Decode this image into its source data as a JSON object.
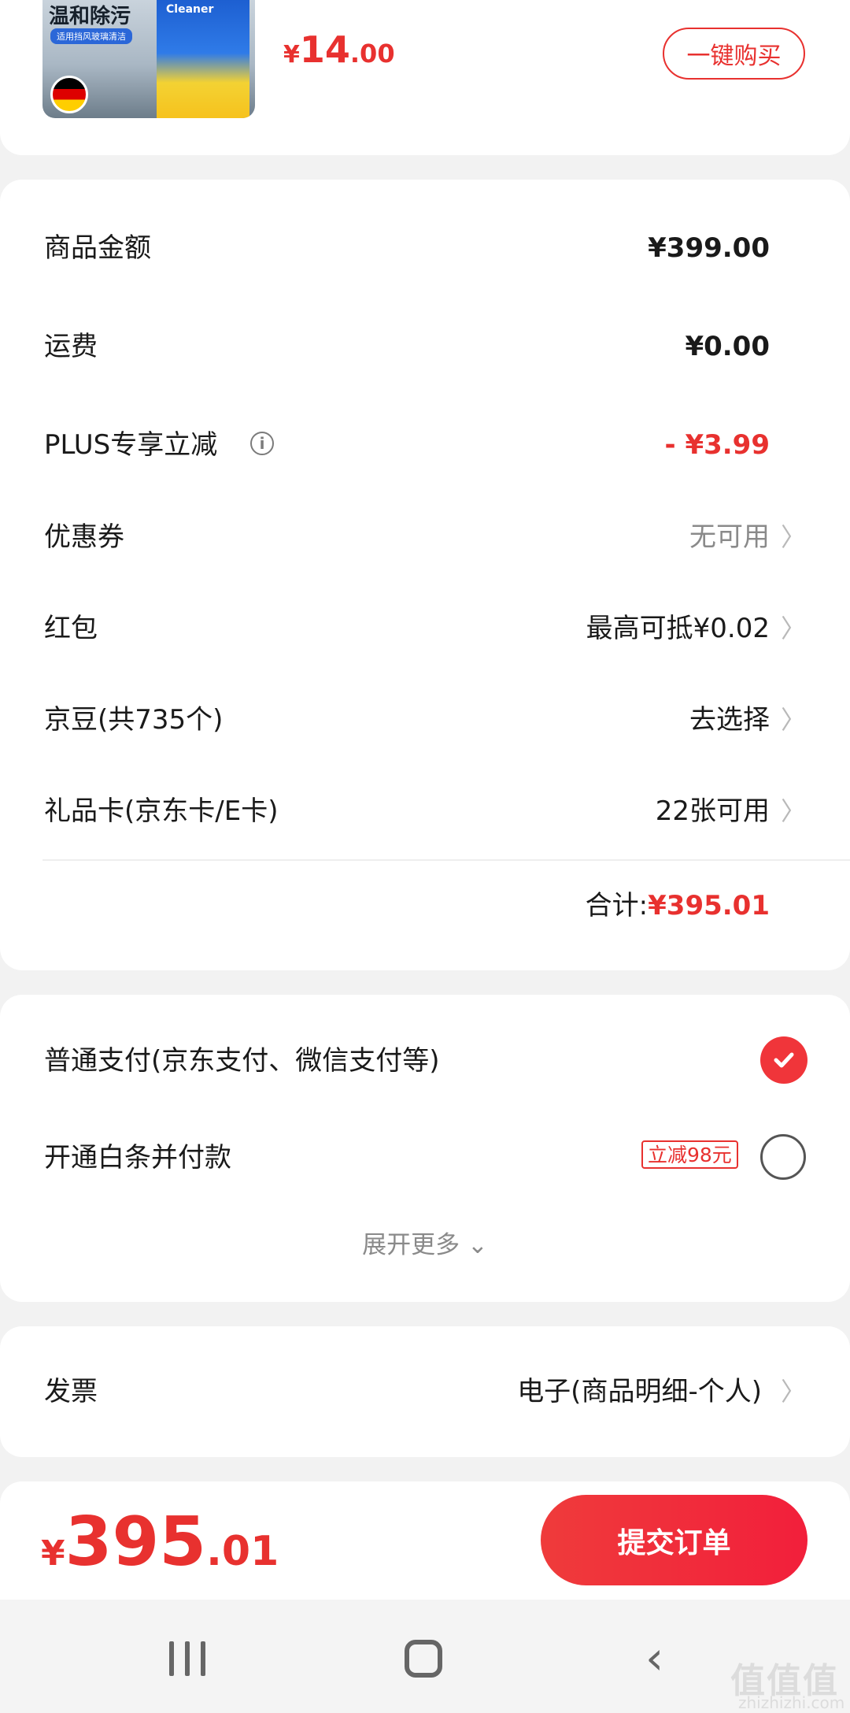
{
  "product": {
    "thumb_title": "温和除污",
    "thumb_sub": "适用挡风玻璃清洁",
    "pack_label": "Cleaner",
    "price_currency": "¥",
    "price_int": "14",
    "price_dec": ".00",
    "buy_button": "一键购买"
  },
  "summary": {
    "rows": [
      {
        "label": "商品金额",
        "value": "¥399.00"
      },
      {
        "label": "运费",
        "value": "¥0.00"
      },
      {
        "label": "PLUS专享立减",
        "value": "- ¥3.99",
        "info_icon": "i"
      },
      {
        "label": "优惠券",
        "value": "无可用"
      },
      {
        "label": "红包",
        "value": "最高可抵¥0.02"
      },
      {
        "label": "京豆(共735个)",
        "value": "去选择"
      },
      {
        "label": "礼品卡(京东卡/E卡)",
        "value": "22张可用"
      }
    ],
    "total_label": "合计:",
    "total_amount": "¥395.01",
    "chevron": "〉"
  },
  "payment": {
    "option1": "普通支付(京东支付、微信支付等)",
    "option2": "开通白条并付款",
    "promo": "立减98元",
    "expand": "展开更多 ⌄",
    "check_mark": "✓"
  },
  "invoice": {
    "label": "发票",
    "value": "电子(商品明细-个人)"
  },
  "footer": {
    "currency": "¥",
    "amount_int": "395",
    "amount_dec": ".01",
    "submit": "提交订单"
  },
  "nav": {
    "back_glyph": "‹"
  },
  "watermark": {
    "text": "值值值",
    "domain": "zhizhizhi.com"
  },
  "colors": {
    "accent_red": "#e8312f",
    "gray_text": "#8a8a8a"
  }
}
